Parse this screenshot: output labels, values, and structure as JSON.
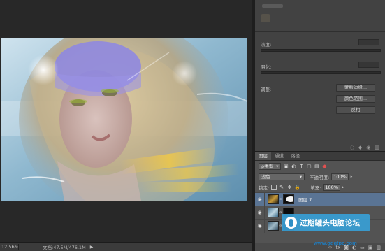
{
  "status_bar": {
    "zoom": "12.56%",
    "doc_info": "文档:47.5M/476.1M",
    "arrow": "▶"
  },
  "properties": {
    "density_label": "浓度:",
    "feather_label": "羽化:",
    "adjust_label": "调整:",
    "btn_refine": "蒙版边缘...",
    "btn_color_range": "颜色范围...",
    "btn_invert": "反相"
  },
  "layers": {
    "tabs": [
      "图层",
      "通道",
      "路径"
    ],
    "filter_kind": "ρ类型",
    "blend_mode": "滤色",
    "opacity_label": "不透明度:",
    "opacity_value": "100%",
    "lock_label": "锁定:",
    "fill_label": "填充:",
    "fill_value": "100%",
    "items": [
      {
        "name": "图层 7"
      },
      {
        "name": ""
      },
      {
        "name": ""
      }
    ]
  },
  "watermark": {
    "text": "过期罐头电脑论坛",
    "url": "www.gqgtpc.com"
  },
  "colors": {
    "panel_bg": "#535353",
    "selected_layer": "#5a7494",
    "watermark_blue": "#38a0d6"
  },
  "icons": {
    "eye": "eye-icon",
    "chain": "chain-link-icon",
    "search": "search-icon",
    "trash": "trash-icon"
  }
}
